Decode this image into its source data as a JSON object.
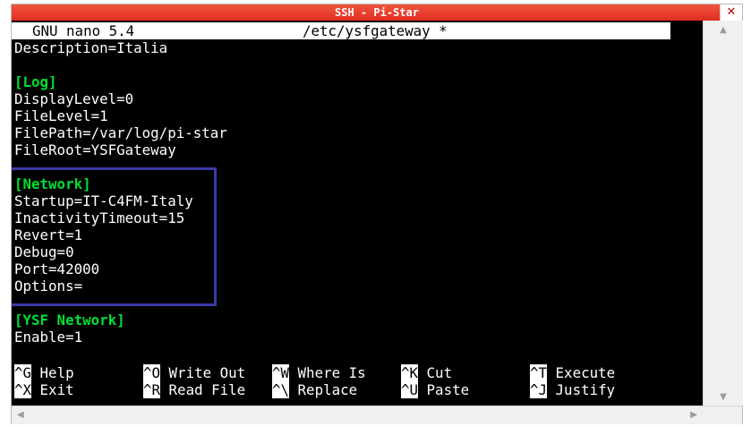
{
  "window": {
    "title": "SSH - Pi-Star",
    "close_glyph": "✕"
  },
  "nano": {
    "version_label": "GNU nano 5.4",
    "filename": "/etc/ysfgateway *"
  },
  "file_lines": [
    {
      "text": "Description=Italia",
      "section": false
    },
    {
      "text": "",
      "section": false
    },
    {
      "text": "[Log]",
      "section": true
    },
    {
      "text": "DisplayLevel=0",
      "section": false
    },
    {
      "text": "FileLevel=1",
      "section": false
    },
    {
      "text": "FilePath=/var/log/pi-star",
      "section": false
    },
    {
      "text": "FileRoot=YSFGateway",
      "section": false
    },
    {
      "text": "",
      "section": false
    },
    {
      "text": "[Network]",
      "section": true
    },
    {
      "text": "Startup=IT-C4FM-Italy",
      "section": false
    },
    {
      "text": "InactivityTimeout=15",
      "section": false
    },
    {
      "text": "Revert=1",
      "section": false
    },
    {
      "text": "Debug=0",
      "section": false
    },
    {
      "text": "Port=42000",
      "section": false
    },
    {
      "text": "Options=",
      "section": false
    },
    {
      "text": "",
      "section": false
    },
    {
      "text": "[YSF Network]",
      "section": true
    },
    {
      "text": "Enable=1",
      "section": false
    }
  ],
  "shortcuts": [
    [
      {
        "key": "^G",
        "label": "Help"
      },
      {
        "key": "^O",
        "label": "Write Out"
      },
      {
        "key": "^W",
        "label": "Where Is"
      },
      {
        "key": "^K",
        "label": "Cut"
      },
      {
        "key": "^T",
        "label": "Execute"
      }
    ],
    [
      {
        "key": "^X",
        "label": "Exit"
      },
      {
        "key": "^R",
        "label": "Read File"
      },
      {
        "key": "^\\",
        "label": "Replace"
      },
      {
        "key": "^U",
        "label": "Paste"
      },
      {
        "key": "^J",
        "label": "Justify"
      }
    ]
  ],
  "scrollbars": {
    "up_arrow": "▲",
    "down_arrow": "▼",
    "left_arrow": "◀",
    "right_arrow": "▶"
  },
  "colors": {
    "titlebar": "#e8402d",
    "section_header": "#00e030",
    "highlight_box": "#3a3aa8",
    "terminal_bg": "#000000"
  }
}
